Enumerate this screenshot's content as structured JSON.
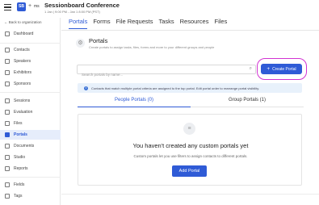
{
  "header": {
    "logo_text": "SB",
    "plus": "+",
    "org_tag": "ms",
    "title": "Sessionboard Conference",
    "date": "1 Jan | 9:00 PM - Jan 1 8:00 PM (PST)"
  },
  "sidebar": {
    "back_label": "← Back to organization",
    "items": [
      {
        "label": "Dashboard",
        "icon": "dashboard-icon"
      },
      {
        "label": "Contacts",
        "icon": "contacts-icon"
      },
      {
        "label": "Speakers",
        "icon": "speakers-icon"
      },
      {
        "label": "Exhibitors",
        "icon": "exhibitors-icon"
      },
      {
        "label": "Sponsors",
        "icon": "sponsors-icon"
      },
      {
        "label": "Sessions",
        "icon": "sessions-icon"
      },
      {
        "label": "Evaluation",
        "icon": "evaluation-icon"
      },
      {
        "label": "Files",
        "icon": "files-icon"
      },
      {
        "label": "Portals",
        "icon": "portals-icon"
      },
      {
        "label": "Documents",
        "icon": "documents-icon"
      },
      {
        "label": "Studio",
        "icon": "studio-icon"
      },
      {
        "label": "Reports",
        "icon": "reports-icon"
      },
      {
        "label": "Fields",
        "icon": "fields-icon"
      },
      {
        "label": "Tags",
        "icon": "tags-icon"
      }
    ]
  },
  "tabs": [
    "Portals",
    "Forms",
    "File Requests",
    "Tasks",
    "Resources",
    "Files"
  ],
  "page": {
    "title": "Portals",
    "subtitle": "Create portals to assign tasks, files, forms and more to your different groups and people",
    "search_placeholder": "Search portals by name...",
    "create_button": "Create Portal",
    "info_text": "Contacts that match multiple portal criteria are assigned to the top portal. Edit portal order to rearrange portal visibility.",
    "people_tab": "People Portals (0)",
    "group_tab": "Group Portals (1)",
    "empty_title": "You haven't created any custom portals yet",
    "empty_desc": "Custom portals let you use filters to assign contacts to different portals.",
    "add_button": "Add Portal"
  },
  "colors": {
    "accent": "#2f5bd6",
    "highlight": "#d233d2",
    "info_bg": "#e8f1fb"
  }
}
